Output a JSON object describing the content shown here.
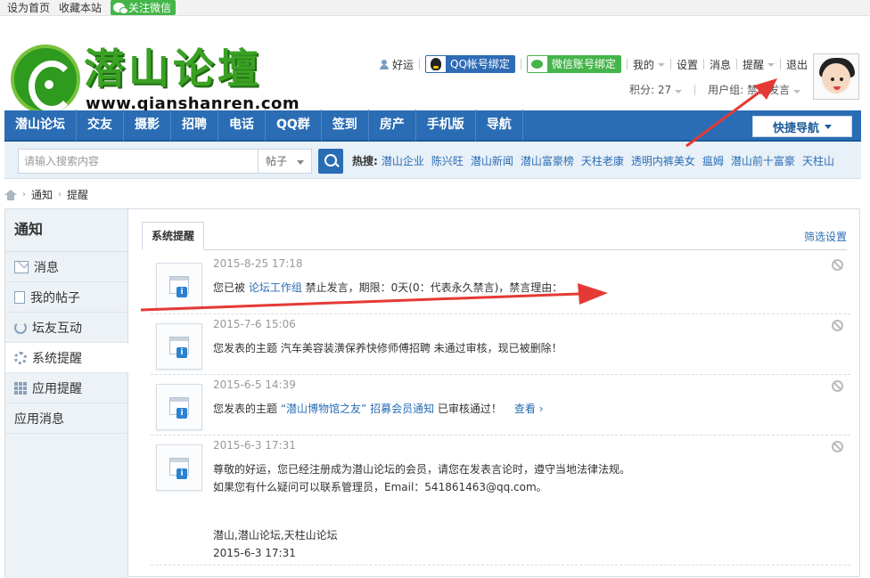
{
  "topbar": {
    "set_home": "设为首页",
    "bookmark": "收藏本站",
    "follow_wechat": "关注微信"
  },
  "logo": {
    "text": "潜山论壇",
    "url": "www.qianshanren.com"
  },
  "user": {
    "name": "好运",
    "qq_bind": "QQ帐号绑定",
    "wechat_bind": "微信账号绑定",
    "my": "我的",
    "settings": "设置",
    "messages": "消息",
    "remind": "提醒",
    "logout": "退出",
    "points": "积分: 27",
    "usergroup": "用户组: 禁止发言"
  },
  "nav": {
    "items": [
      "潜山论坛",
      "交友",
      "摄影",
      "招聘",
      "电话",
      "QQ群",
      "签到",
      "房产",
      "手机版",
      "导航"
    ],
    "quick": "快捷导航"
  },
  "search": {
    "placeholder": "请输入搜索内容",
    "type": "帖子",
    "hot_label": "热搜:",
    "hot": [
      "潜山企业",
      "陈兴旺",
      "潜山新闻",
      "潜山富豪榜",
      "天柱老康",
      "透明内裤美女",
      "瘟姆",
      "潜山前十富豪",
      "天柱山"
    ]
  },
  "breadcrumb": {
    "a": "通知",
    "b": "提醒"
  },
  "sidebar": {
    "title": "通知",
    "items": [
      "消息",
      "我的帖子",
      "坛友互动",
      "系统提醒",
      "应用提醒",
      "应用消息"
    ]
  },
  "main": {
    "tab": "系统提醒",
    "filter": "筛选设置",
    "notices": [
      {
        "time": "2015-8-25 17:18",
        "pre": "您已被 ",
        "link": "论坛工作组",
        "post": " 禁止发言，期限：0天(0：代表永久禁言)，禁言理由："
      },
      {
        "time": "2015-7-6 15:06",
        "text": "您发表的主题 汽车美容装潢保养快修师傅招聘 未通过审核，现已被删除！"
      },
      {
        "time": "2015-6-5 14:39",
        "pre": "您发表的主题 ",
        "link": "“潜山博物馆之友” 招募会员通知",
        "post": " 已审核通过！",
        "view": "查看 ›"
      },
      {
        "time": "2015-6-3 17:31",
        "l1": "尊敬的好运，您已经注册成为潜山论坛的会员，请您在发表言论时，遵守当地法律法规。",
        "l2": "如果您有什么疑问可以联系管理员，Email：541861463@qq.com。",
        "l3": "潜山,潜山论坛,天柱山论坛",
        "l4": "2015-6-3 17:31"
      }
    ]
  },
  "colors": {
    "nav_blue": "#2a6db5",
    "logo_green": "#3aa124",
    "arrow_red": "#e53935"
  }
}
